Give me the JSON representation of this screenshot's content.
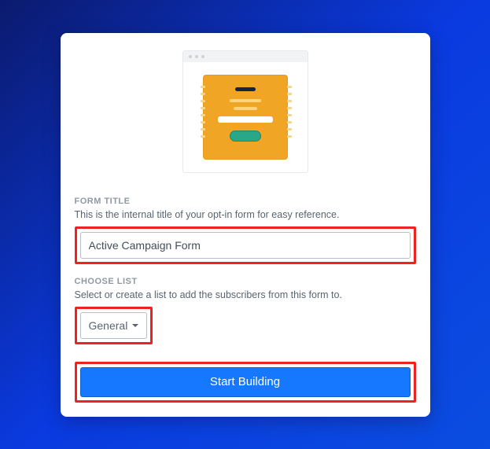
{
  "form_title": {
    "label": "FORM TITLE",
    "description": "This is the internal title of your opt-in form for easy reference.",
    "value": "Active Campaign Form"
  },
  "choose_list": {
    "label": "CHOOSE LIST",
    "description": "Select or create a list to add the subscribers from this form to.",
    "selected": "General"
  },
  "primary_action": "Start Building"
}
